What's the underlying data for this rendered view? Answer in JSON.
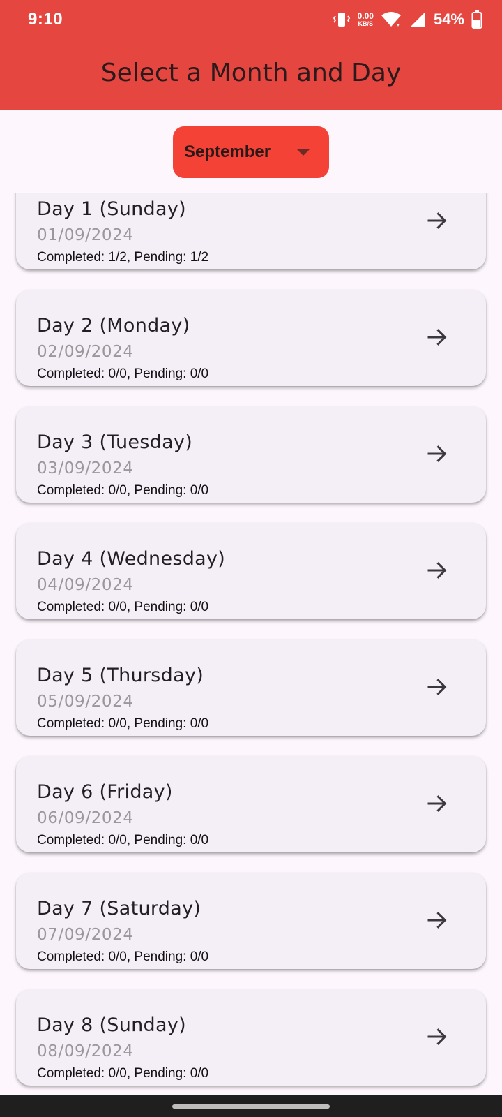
{
  "status_bar": {
    "time": "9:10",
    "net_speed": "0.00",
    "net_unit": "KB/S",
    "battery": "54%",
    "icons": [
      "vibrate-icon",
      "wifi-icon",
      "cell-signal-icon",
      "battery-icon"
    ]
  },
  "app_bar": {
    "title": "Select a Month and Day"
  },
  "month_selector": {
    "selected": "September"
  },
  "days": [
    {
      "title": "Day 1 (Sunday)",
      "date": "01/09/2024",
      "status": "Completed: 1/2, Pending: 1/2"
    },
    {
      "title": "Day 2 (Monday)",
      "date": "02/09/2024",
      "status": "Completed: 0/0, Pending: 0/0"
    },
    {
      "title": "Day 3 (Tuesday)",
      "date": "03/09/2024",
      "status": "Completed: 0/0, Pending: 0/0"
    },
    {
      "title": "Day 4 (Wednesday)",
      "date": "04/09/2024",
      "status": "Completed: 0/0, Pending: 0/0"
    },
    {
      "title": "Day 5 (Thursday)",
      "date": "05/09/2024",
      "status": "Completed: 0/0, Pending: 0/0"
    },
    {
      "title": "Day 6 (Friday)",
      "date": "06/09/2024",
      "status": "Completed: 0/0, Pending: 0/0"
    },
    {
      "title": "Day 7 (Saturday)",
      "date": "07/09/2024",
      "status": "Completed: 0/0, Pending: 0/0"
    },
    {
      "title": "Day 8 (Sunday)",
      "date": "08/09/2024",
      "status": "Completed: 0/0, Pending: 0/0"
    }
  ],
  "colors": {
    "app_bar": "#e64640",
    "dropdown": "#f44336",
    "background": "#fdf7fd",
    "card": "#f4eff6"
  }
}
